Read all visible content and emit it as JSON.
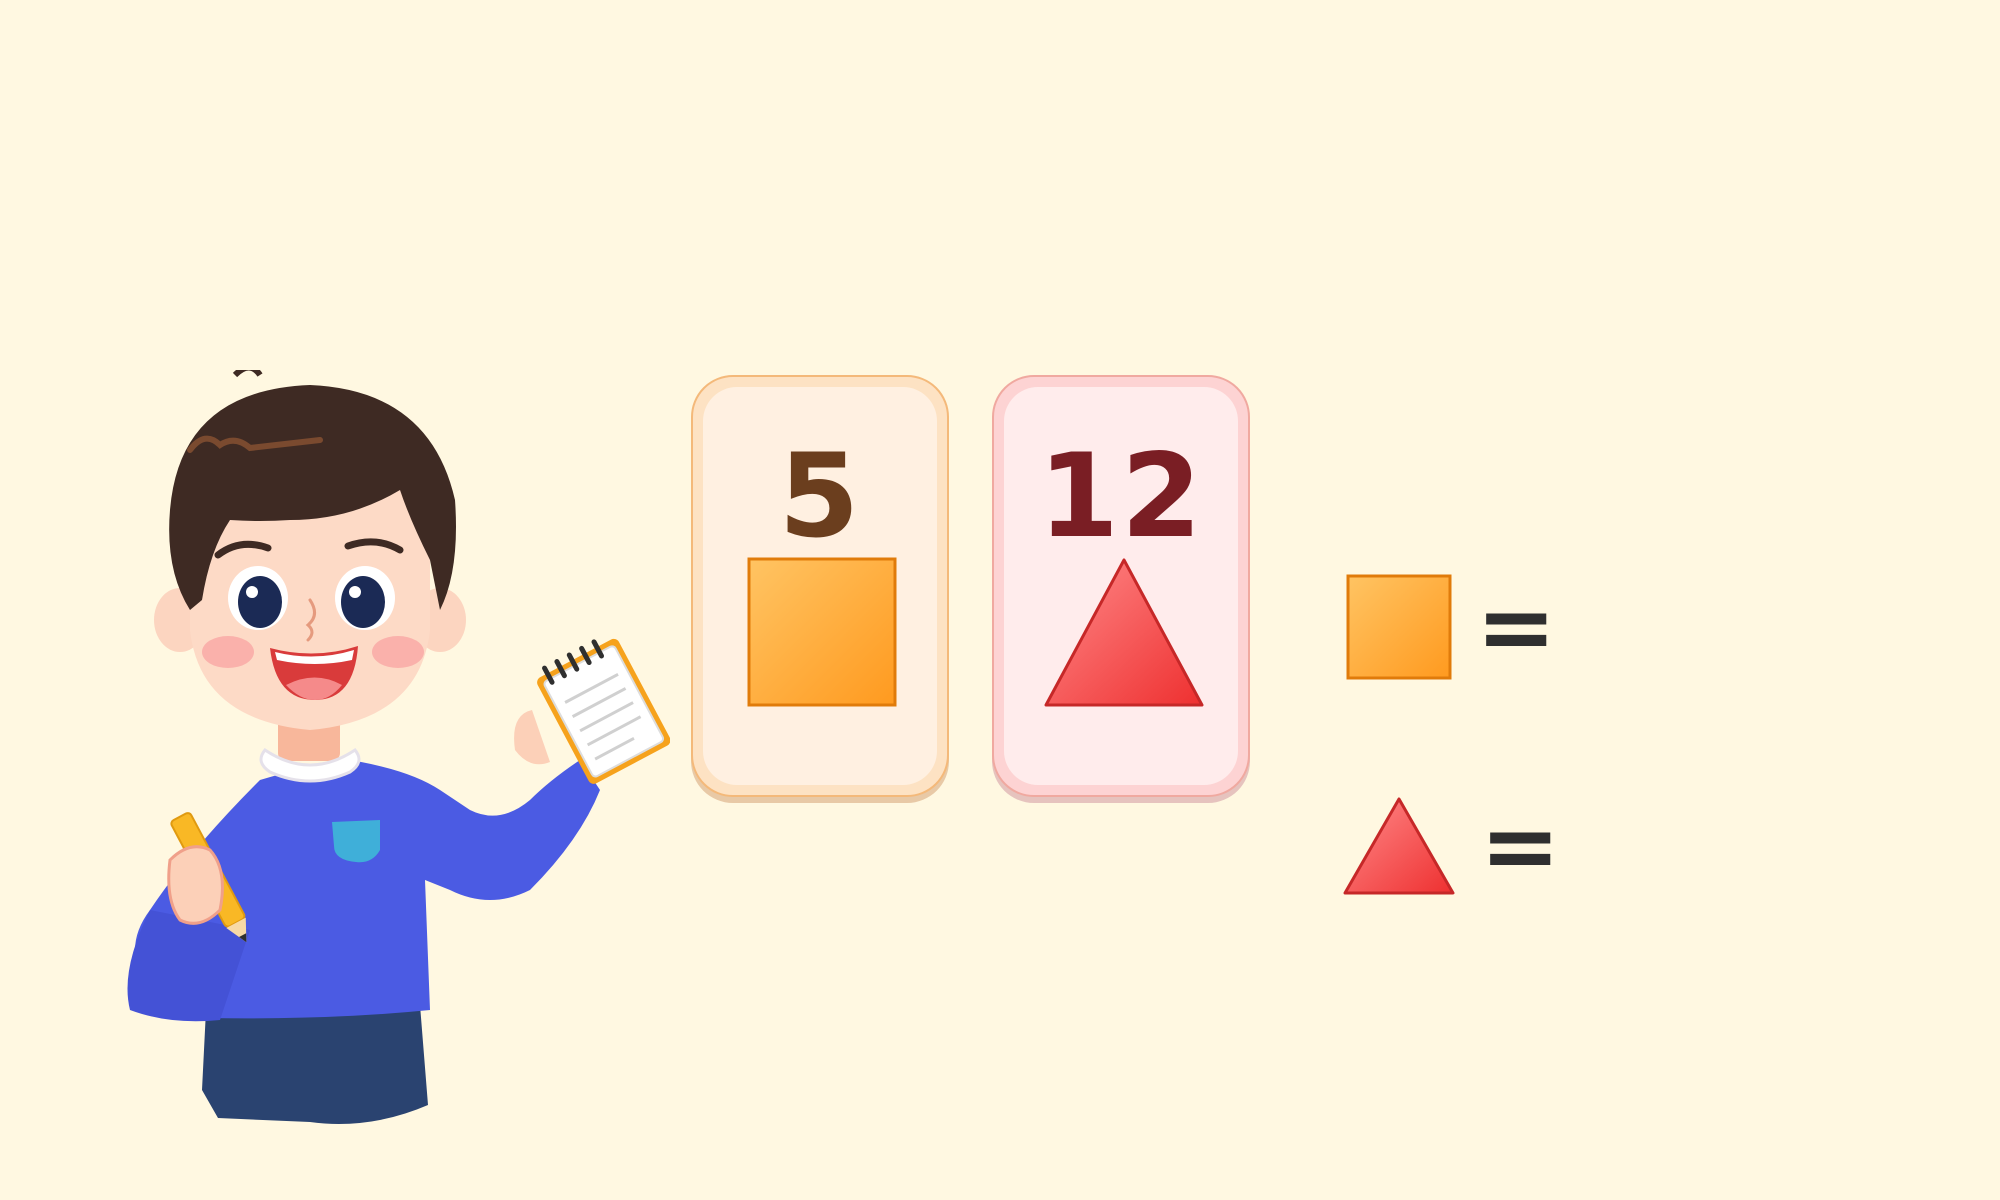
{
  "cards": [
    {
      "number": "5",
      "number_color": "#6B3E1E",
      "shape": "square-icon"
    },
    {
      "number": "12",
      "number_color": "#7A1E24",
      "shape": "triangle-icon"
    }
  ],
  "equations": [
    {
      "shape": "square-icon",
      "operator": "=",
      "answer": ""
    },
    {
      "shape": "triangle-icon",
      "operator": "=",
      "answer": ""
    }
  ],
  "colors": {
    "background": "#FFF8E1",
    "square_fill": "#FFA726",
    "triangle_fill": "#F44336",
    "shirt": "#4B5BE3",
    "pants": "#2A4370",
    "hair": "#3E2A23"
  }
}
